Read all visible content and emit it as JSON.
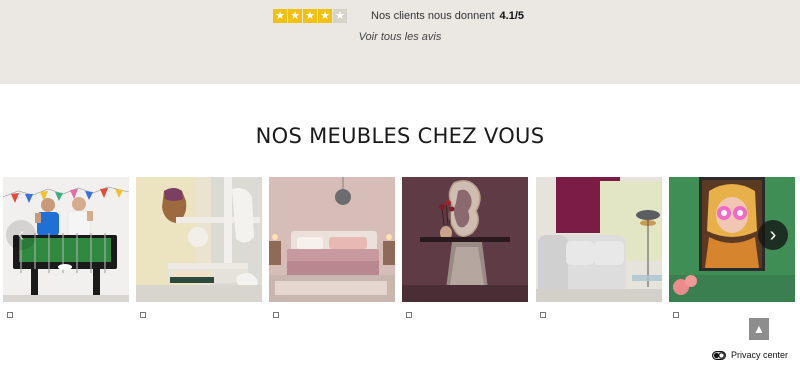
{
  "reviews": {
    "rating_stars": 4,
    "max_stars": 5,
    "text": "Nos clients nous donnent",
    "score": "4.1/5",
    "link": "Voir tous les avis",
    "star_color": "#f2c010"
  },
  "section": {
    "title": "NOS MEUBLES CHEZ VOUS"
  },
  "carousel": {
    "prev_icon": "chevron-left-icon",
    "next_icon": "chevron-right-icon",
    "cards": [
      {
        "scene": "foosball-table-photo",
        "caption": "▯"
      },
      {
        "scene": "side-table-vase-photo",
        "caption": "▯"
      },
      {
        "scene": "pink-bedroom-photo",
        "caption": "▯"
      },
      {
        "scene": "console-mirror-photo",
        "caption": "▯"
      },
      {
        "scene": "white-sofa-lamp-photo",
        "caption": "▯"
      },
      {
        "scene": "pop-art-portrait-photo",
        "caption": "▯"
      }
    ]
  },
  "back_to_top_icon": "arrow-up-icon",
  "privacy": {
    "label": "Privacy center",
    "icon": "toggle-icon"
  }
}
